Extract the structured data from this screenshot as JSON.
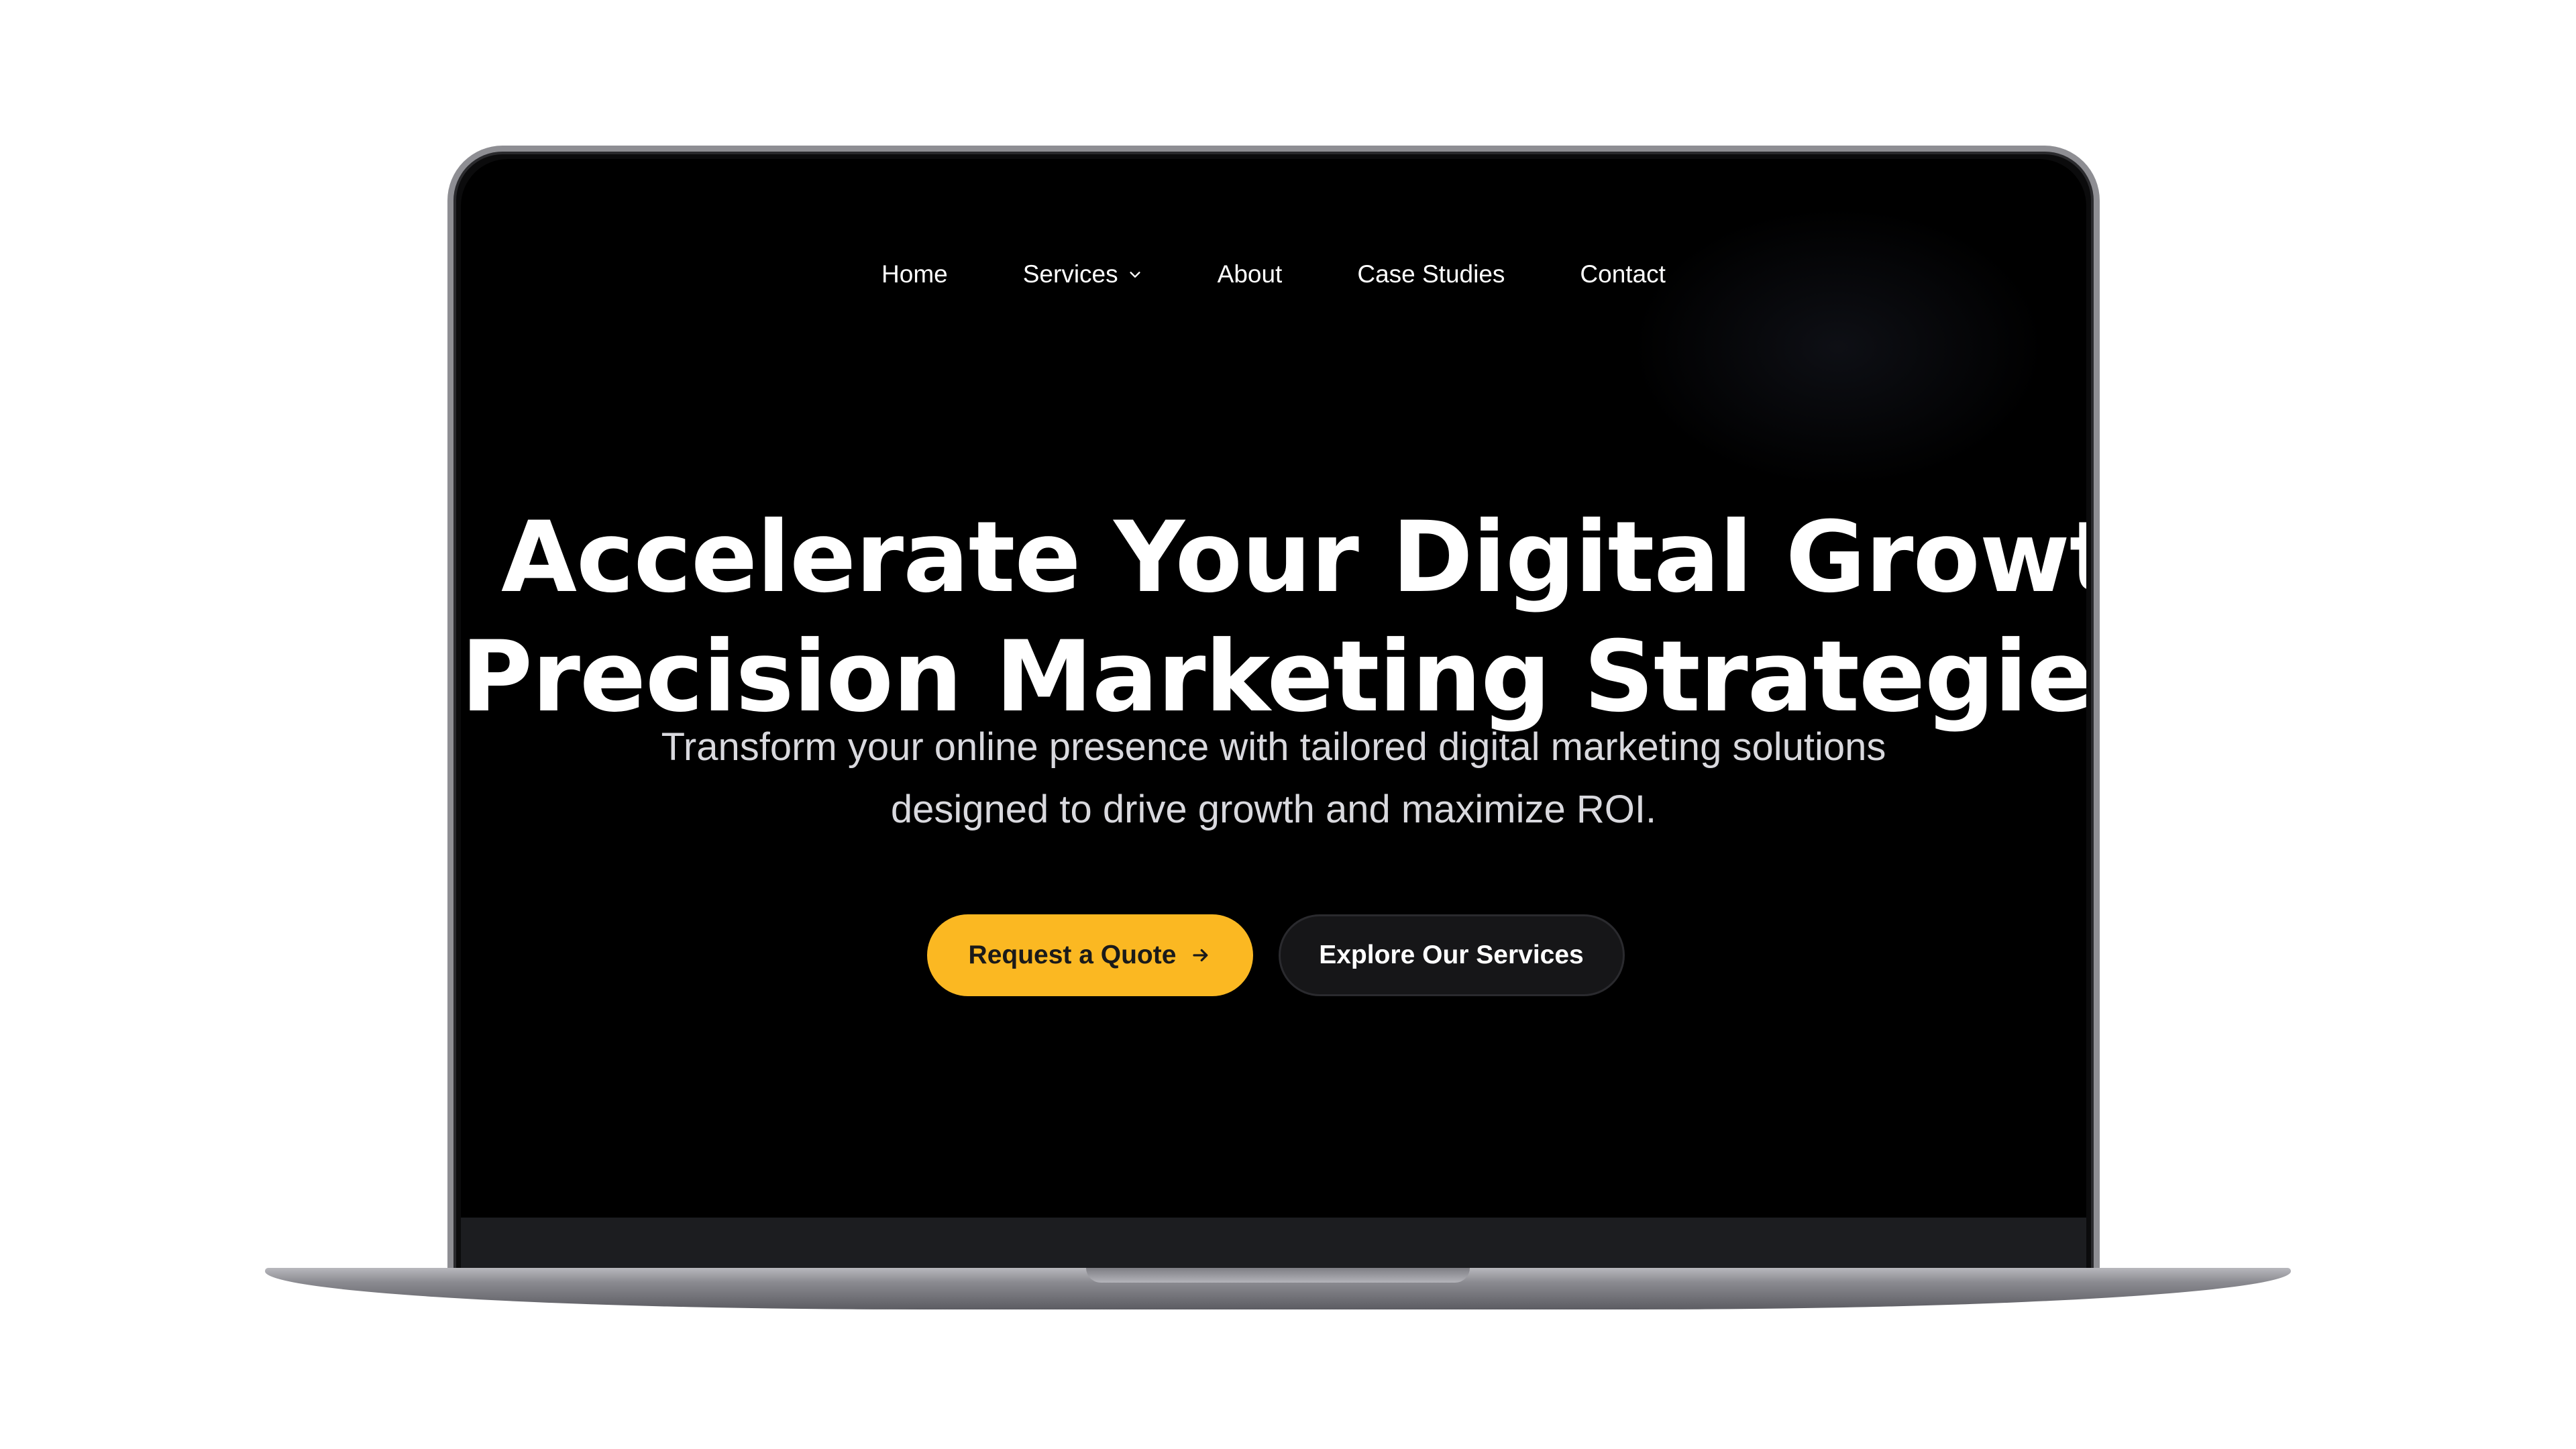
{
  "nav": {
    "items": [
      {
        "label": "Home"
      },
      {
        "label": "Services",
        "has_dropdown": true
      },
      {
        "label": "About"
      },
      {
        "label": "Case Studies"
      },
      {
        "label": "Contact"
      }
    ]
  },
  "hero": {
    "title_line1": "Accelerate Your Digital Growth with",
    "title_line2": "Precision Marketing Strategies",
    "subtitle_line1": "Transform your online presence with tailored digital marketing solutions",
    "subtitle_line2": "designed to drive growth and maximize ROI."
  },
  "cta": {
    "primary_label": "Request a Quote",
    "primary_icon": "arrow-right-icon",
    "secondary_label": "Explore Our Services"
  },
  "colors": {
    "page_background": "#ffffff",
    "screen_background": "#000000",
    "accent": "#fbb822",
    "secondary_button": "#161618",
    "text_primary": "#ffffff",
    "text_muted": "#d9d9de"
  }
}
